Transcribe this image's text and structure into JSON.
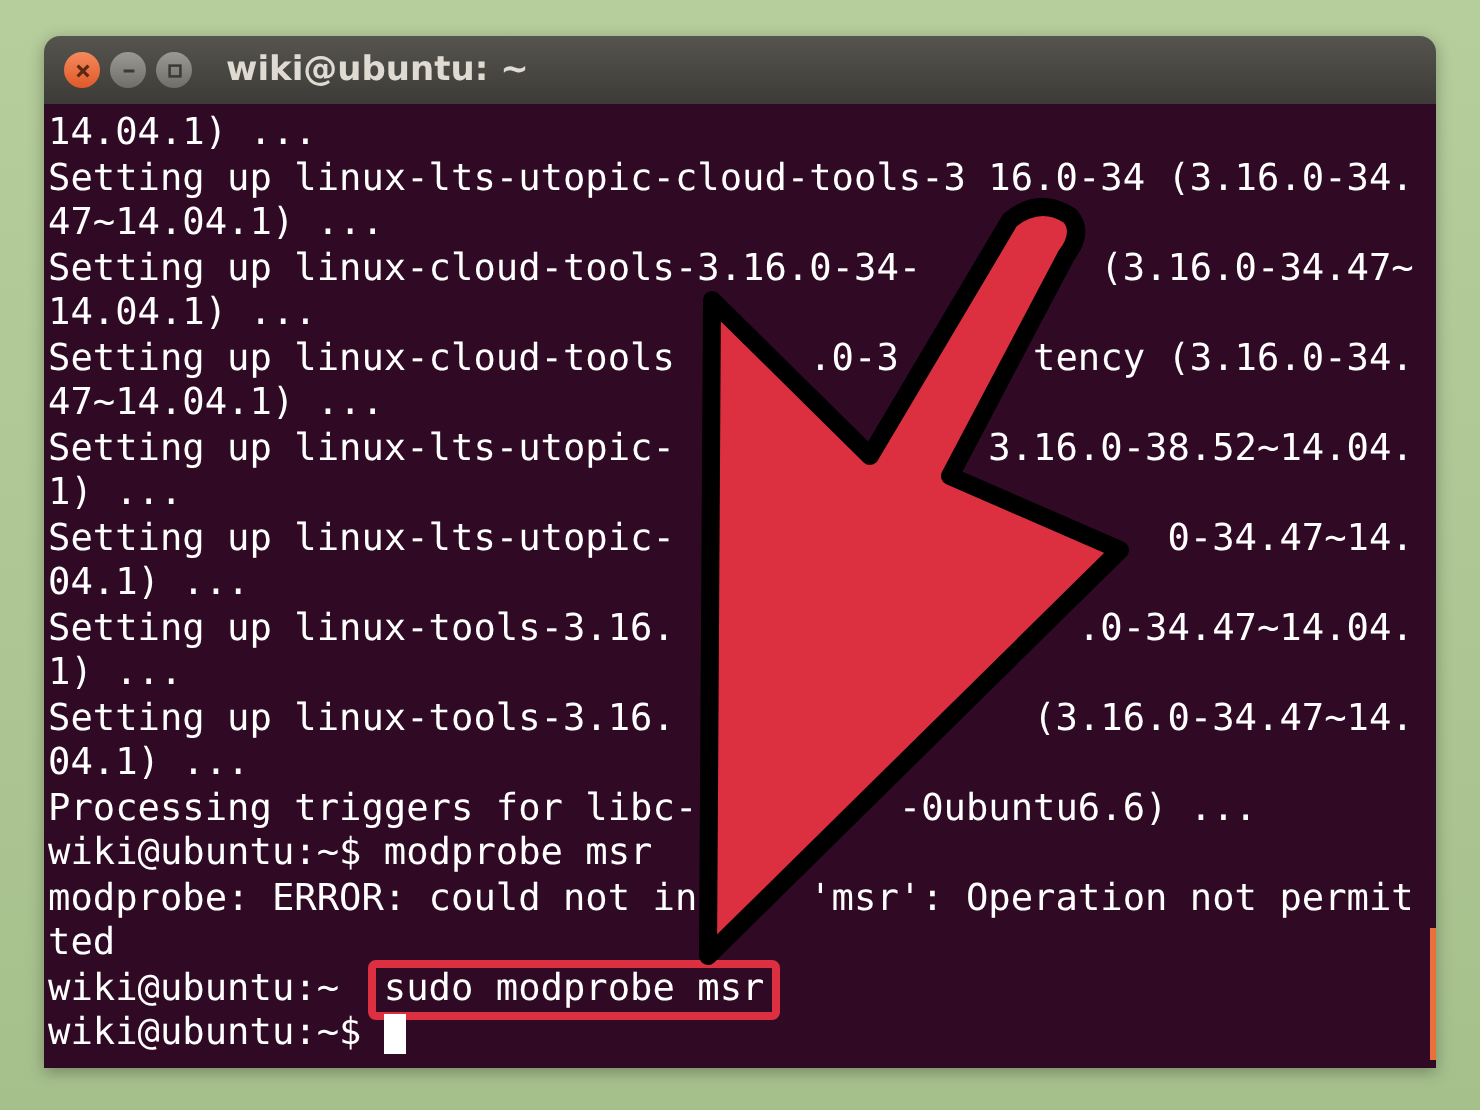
{
  "window": {
    "title": "wiki@ubuntu: ~"
  },
  "lines": [
    {
      "segments": [
        "14.04.1) ..."
      ]
    },
    {
      "segments": [
        "Setting up linux-lts-utopic-cloud-tools-3",
        "16.0-34 (3.16.0-34."
      ]
    },
    {
      "segments": [
        "47~14.04.1) ..."
      ]
    },
    {
      "segments": [
        "Setting up linux-cloud-tools-3.16.0-34-",
        "(3.16.0-34.47~"
      ]
    },
    {
      "segments": [
        "14.04.1) ..."
      ]
    },
    {
      "segments": [
        "Setting up linux-cloud-tools",
        ".0-3",
        "tency (3.16.0-34."
      ]
    },
    {
      "segments": [
        "47~14.04.1) ..."
      ]
    },
    {
      "segments": [
        "Setting up linux-lts-utopic-",
        "3.16.0-38.52~14.04."
      ]
    },
    {
      "segments": [
        "1) ..."
      ]
    },
    {
      "segments": [
        "Setting up linux-lts-utopic-",
        "0-34.47~14."
      ]
    },
    {
      "segments": [
        "04.1) ..."
      ]
    },
    {
      "segments": [
        "Setting up linux-tools-3.16.",
        ".0-34.47~14.04."
      ]
    },
    {
      "segments": [
        "1) ..."
      ]
    },
    {
      "segments": [
        "Setting up linux-tools-3.16.",
        "(3.16.0-34.47~14."
      ]
    },
    {
      "segments": [
        "04.1) ..."
      ]
    },
    {
      "segments": [
        "Processing triggers for libc-",
        "-0ubuntu6.6) ..."
      ]
    },
    {
      "segments": [
        "wiki@ubuntu:~$ modprobe msr"
      ]
    },
    {
      "segments": [
        "modprobe: ERROR: could not in",
        "'msr': Operation not permit"
      ]
    },
    {
      "segments": [
        "ted"
      ]
    },
    {
      "segments": [
        "wiki@ubuntu:~",
        "sudo modprobe msr"
      ],
      "highlighted": true
    },
    {
      "segments": [
        "wiki@ubuntu:~$"
      ],
      "cursor": true
    }
  ]
}
